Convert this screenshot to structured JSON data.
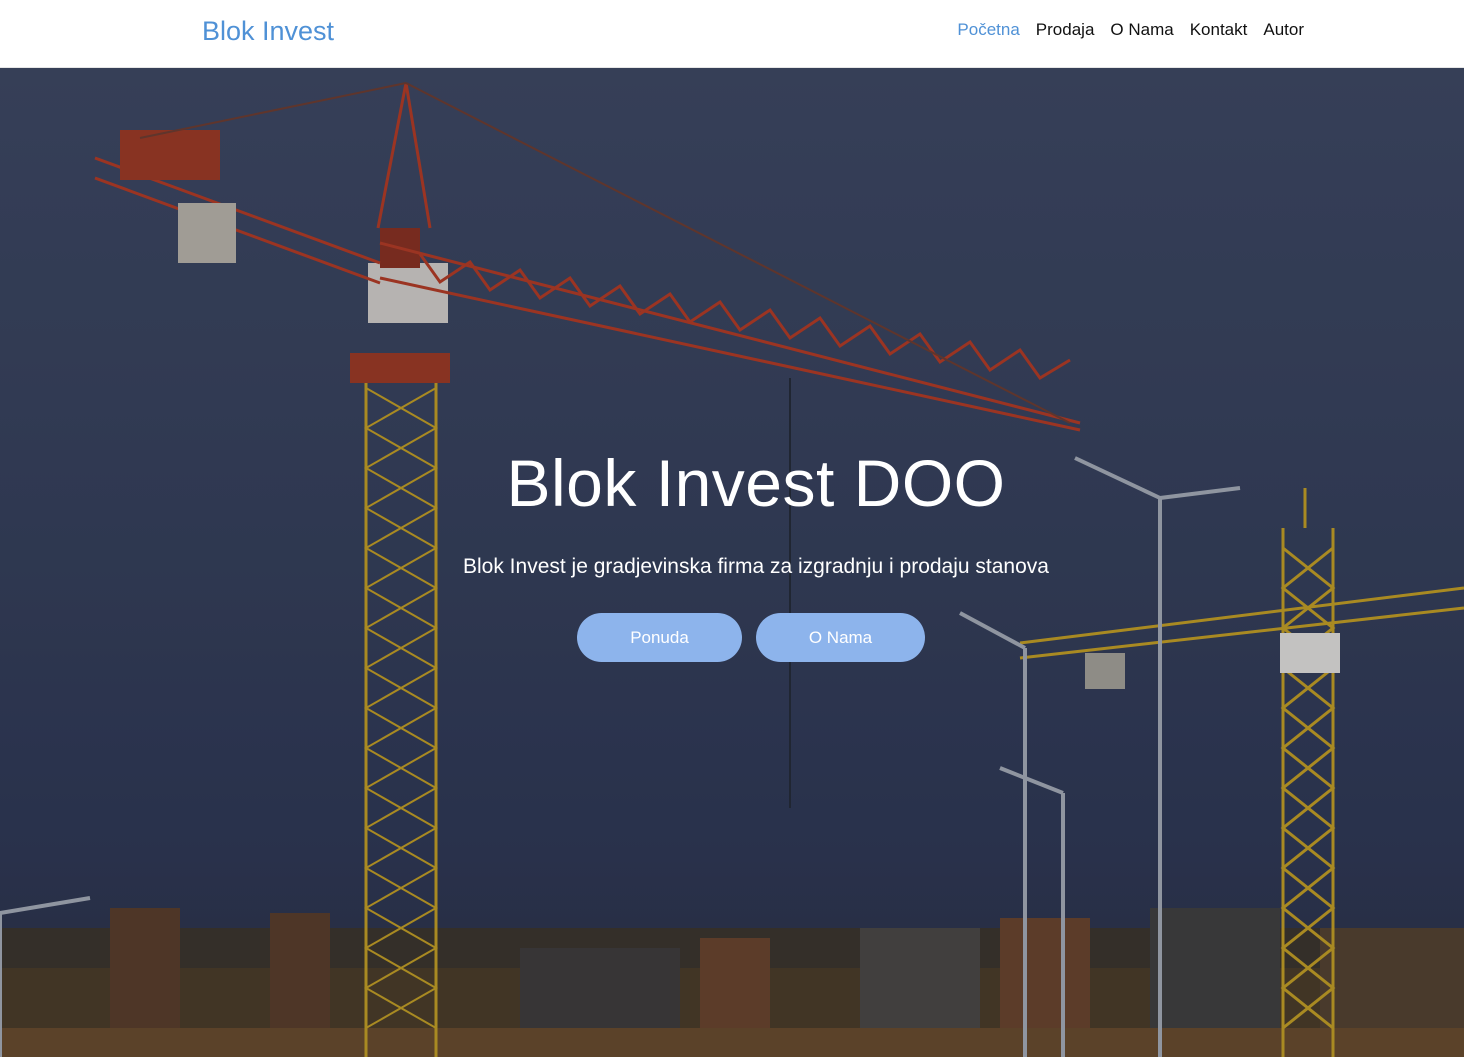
{
  "brand": "Blok Invest",
  "nav": {
    "items": [
      "Početna",
      "Prodaja",
      "O Nama",
      "Kontakt",
      "Autor"
    ],
    "active_index": 0
  },
  "hero": {
    "title": "Blok Invest DOO",
    "subtitle": "Blok Invest je gradjevinska firma za izgradnju i prodaju stanova",
    "buttons": [
      "Ponuda",
      "O Nama"
    ],
    "background_image": "construction-cranes-photo"
  },
  "colors": {
    "brand": "#4f91d6",
    "nav_active": "#4f91d6",
    "nav_text": "#111111",
    "button_bg": "#8db4ec",
    "button_text": "#ffffff",
    "hero_text": "#ffffff"
  }
}
